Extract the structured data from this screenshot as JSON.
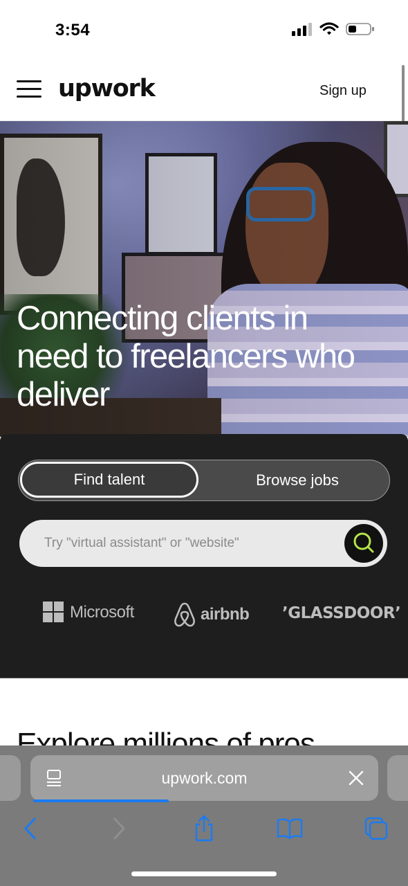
{
  "status_bar": {
    "time": "3:54"
  },
  "header": {
    "logo_text": "upwork",
    "signup_label": "Sign up"
  },
  "hero": {
    "title": "Connecting clients in need to freelancers who deliver"
  },
  "search_panel": {
    "tabs": [
      {
        "label": "Find talent",
        "active": true
      },
      {
        "label": "Browse jobs",
        "active": false
      }
    ],
    "search_placeholder": "Try \"virtual assistant\" or \"website\"",
    "accent_color": "#b5e34a"
  },
  "trusted_logos": {
    "microsoft": "Microsoft",
    "airbnb": "airbnb",
    "glassdoor": "GLASSDOOR"
  },
  "section_heading": "Explore millions of pros",
  "browser": {
    "url": "upwork.com",
    "progress_fraction": 0.39,
    "accent_color": "#1a7bf2"
  }
}
